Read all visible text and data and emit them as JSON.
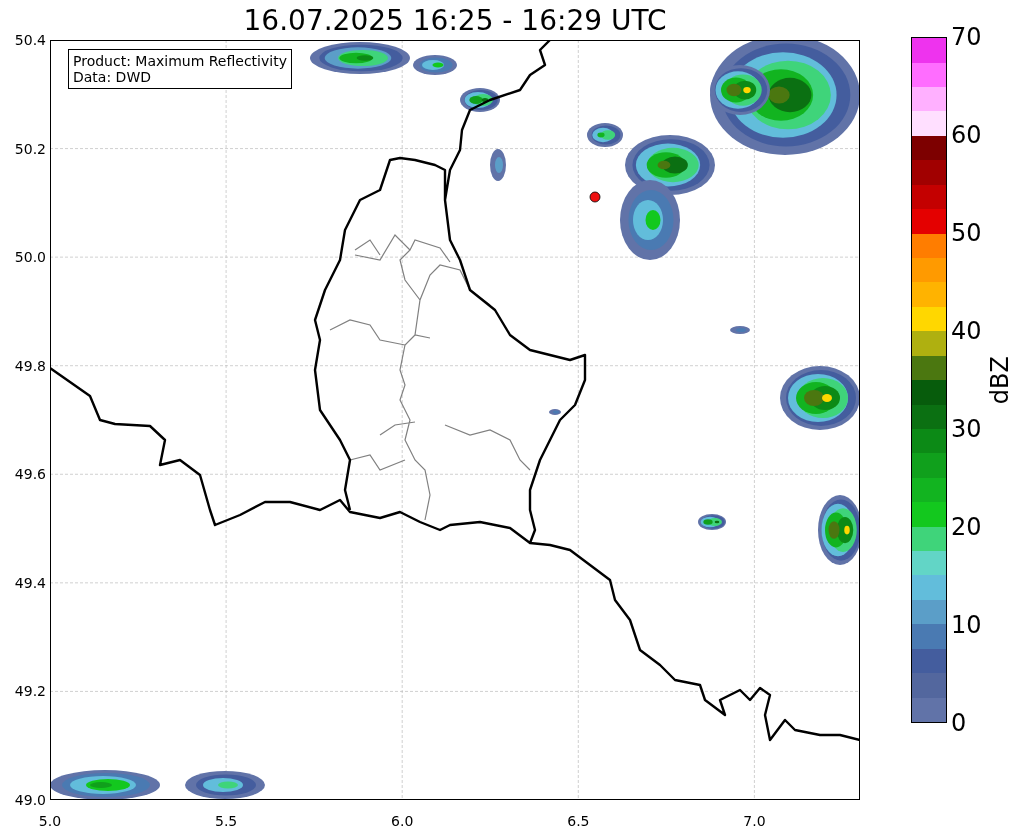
{
  "title": "16.07.2025 16:25 - 16:29 UTC",
  "map": {
    "info_lines": [
      "Product: Maximum Reflectivity",
      "Data: DWD"
    ],
    "y_ticks": [
      "50.4",
      "50.2",
      "50.0",
      "49.8",
      "49.6",
      "49.4",
      "49.2",
      "49.0"
    ],
    "x_ticks": [
      "5.0",
      "5.5",
      "6.0",
      "6.5",
      "7.0"
    ]
  },
  "colorbar": {
    "label": "dBZ",
    "ticks": [
      "70",
      "60",
      "50",
      "40",
      "30",
      "20",
      "10",
      "0"
    ],
    "segments": [
      {
        "color": "#6173a8"
      },
      {
        "color": "#53679e"
      },
      {
        "color": "#445d9e"
      },
      {
        "color": "#4a7ab2"
      },
      {
        "color": "#5b9ec8"
      },
      {
        "color": "#62bddb"
      },
      {
        "color": "#62d5c6"
      },
      {
        "color": "#3fd47a"
      },
      {
        "color": "#13c81e"
      },
      {
        "color": "#12b420"
      },
      {
        "color": "#10a01c"
      },
      {
        "color": "#0c8a16"
      },
      {
        "color": "#0b7012"
      },
      {
        "color": "#075c0c"
      },
      {
        "color": "#4b7710"
      },
      {
        "color": "#afb010"
      },
      {
        "color": "#ffd700"
      },
      {
        "color": "#ffb300"
      },
      {
        "color": "#ff9a00"
      },
      {
        "color": "#ff7d00"
      },
      {
        "color": "#e40000"
      },
      {
        "color": "#c40000"
      },
      {
        "color": "#a10000"
      },
      {
        "color": "#7d0000"
      },
      {
        "color": "#ffdfff"
      },
      {
        "color": "#ffb0ff"
      },
      {
        "color": "#ff6dff"
      },
      {
        "color": "#ee33ee"
      }
    ]
  }
}
